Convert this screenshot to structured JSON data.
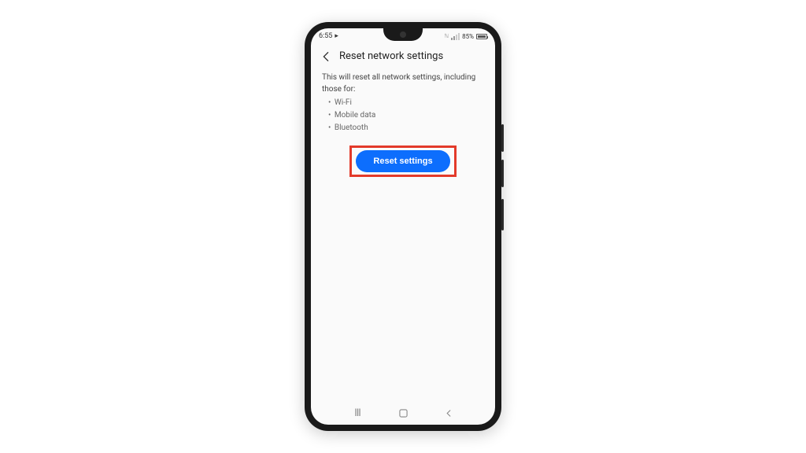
{
  "status": {
    "time": "6:55",
    "battery_pct": "85%"
  },
  "header": {
    "title": "Reset network settings"
  },
  "content": {
    "description": "This will reset all network settings, including those for:",
    "bullets": [
      "Wi-Fi",
      "Mobile data",
      "Bluetooth"
    ],
    "button_label": "Reset settings"
  },
  "colors": {
    "primary_button": "#0d6efd",
    "highlight_border": "#e33a2a"
  }
}
